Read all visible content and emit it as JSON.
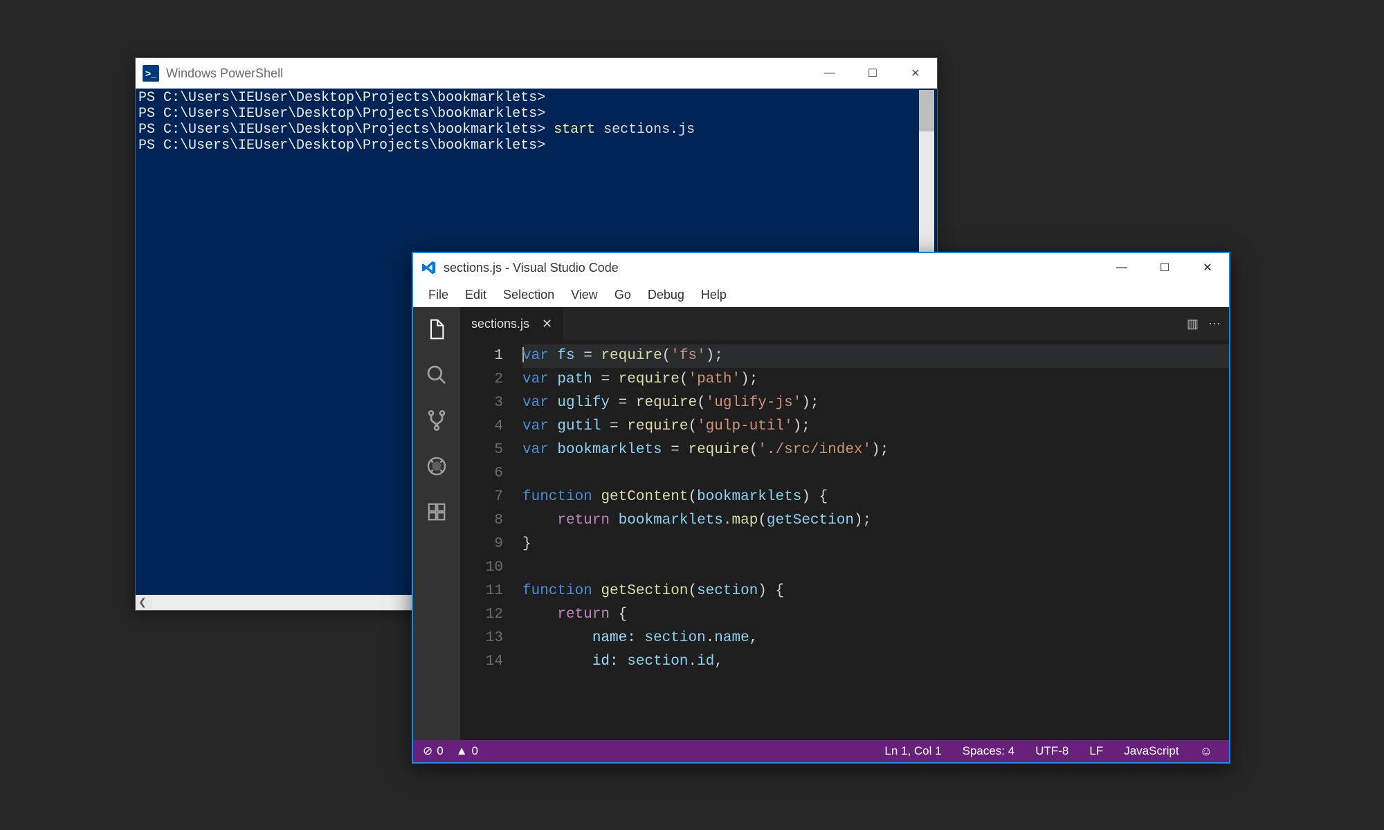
{
  "powershell": {
    "title": "Windows PowerShell",
    "win_buttons": {
      "min": "—",
      "max": "☐",
      "close": "✕"
    },
    "prompt": "PS C:\\Users\\IEUser\\Desktop\\Projects\\bookmarklets>",
    "command_cmd": "start",
    "command_arg": "sections.js",
    "lines": [
      {
        "type": "prompt_only"
      },
      {
        "type": "prompt_only"
      },
      {
        "type": "command"
      },
      {
        "type": "prompt_only"
      }
    ]
  },
  "vscode": {
    "title": "sections.js - Visual Studio Code",
    "win_buttons": {
      "min": "—",
      "max": "☐",
      "close": "✕"
    },
    "menu": [
      "File",
      "Edit",
      "Selection",
      "View",
      "Go",
      "Debug",
      "Help"
    ],
    "activity_icons": [
      "files-icon",
      "search-icon",
      "git-icon",
      "debug-icon",
      "extensions-icon"
    ],
    "tab": {
      "name": "sections.js",
      "close": "✕"
    },
    "tab_actions": {
      "split": "▥",
      "more": "⋯"
    },
    "code_lines": [
      {
        "n": 1,
        "current": true,
        "tokens": [
          [
            "kw",
            "var"
          ],
          [
            "punc",
            " "
          ],
          [
            "var",
            "fs"
          ],
          [
            "punc",
            " = "
          ],
          [
            "fn",
            "require"
          ],
          [
            "punc",
            "("
          ],
          [
            "str",
            "'fs'"
          ],
          [
            "punc",
            ");"
          ]
        ]
      },
      {
        "n": 2,
        "tokens": [
          [
            "kw",
            "var"
          ],
          [
            "punc",
            " "
          ],
          [
            "var",
            "path"
          ],
          [
            "punc",
            " = "
          ],
          [
            "fn",
            "require"
          ],
          [
            "punc",
            "("
          ],
          [
            "str",
            "'path'"
          ],
          [
            "punc",
            ");"
          ]
        ]
      },
      {
        "n": 3,
        "tokens": [
          [
            "kw",
            "var"
          ],
          [
            "punc",
            " "
          ],
          [
            "var",
            "uglify"
          ],
          [
            "punc",
            " = "
          ],
          [
            "fn",
            "require"
          ],
          [
            "punc",
            "("
          ],
          [
            "str",
            "'uglify-js'"
          ],
          [
            "punc",
            ");"
          ]
        ]
      },
      {
        "n": 4,
        "tokens": [
          [
            "kw",
            "var"
          ],
          [
            "punc",
            " "
          ],
          [
            "var",
            "gutil"
          ],
          [
            "punc",
            " = "
          ],
          [
            "fn",
            "require"
          ],
          [
            "punc",
            "("
          ],
          [
            "str",
            "'gulp-util'"
          ],
          [
            "punc",
            ");"
          ]
        ]
      },
      {
        "n": 5,
        "tokens": [
          [
            "kw",
            "var"
          ],
          [
            "punc",
            " "
          ],
          [
            "var",
            "bookmarklets"
          ],
          [
            "punc",
            " = "
          ],
          [
            "fn",
            "require"
          ],
          [
            "punc",
            "("
          ],
          [
            "str",
            "'./src/index'"
          ],
          [
            "punc",
            ");"
          ]
        ]
      },
      {
        "n": 6,
        "tokens": []
      },
      {
        "n": 7,
        "tokens": [
          [
            "kw",
            "function"
          ],
          [
            "punc",
            " "
          ],
          [
            "fn",
            "getContent"
          ],
          [
            "punc",
            "("
          ],
          [
            "var",
            "bookmarklets"
          ],
          [
            "punc",
            ") {"
          ]
        ]
      },
      {
        "n": 8,
        "tokens": [
          [
            "punc",
            "    "
          ],
          [
            "ret",
            "return"
          ],
          [
            "punc",
            " "
          ],
          [
            "var",
            "bookmarklets"
          ],
          [
            "punc",
            "."
          ],
          [
            "fn",
            "map"
          ],
          [
            "punc",
            "("
          ],
          [
            "var",
            "getSection"
          ],
          [
            "punc",
            ");"
          ]
        ]
      },
      {
        "n": 9,
        "tokens": [
          [
            "punc",
            "}"
          ]
        ]
      },
      {
        "n": 10,
        "tokens": []
      },
      {
        "n": 11,
        "tokens": [
          [
            "kw",
            "function"
          ],
          [
            "punc",
            " "
          ],
          [
            "fn",
            "getSection"
          ],
          [
            "punc",
            "("
          ],
          [
            "var",
            "section"
          ],
          [
            "punc",
            ") {"
          ]
        ]
      },
      {
        "n": 12,
        "tokens": [
          [
            "punc",
            "    "
          ],
          [
            "ret",
            "return"
          ],
          [
            "punc",
            " {"
          ]
        ]
      },
      {
        "n": 13,
        "tokens": [
          [
            "punc",
            "        "
          ],
          [
            "prop",
            "name"
          ],
          [
            "punc",
            ": "
          ],
          [
            "var",
            "section"
          ],
          [
            "punc",
            "."
          ],
          [
            "var",
            "name"
          ],
          [
            "punc",
            ","
          ]
        ]
      },
      {
        "n": 14,
        "tokens": [
          [
            "punc",
            "        "
          ],
          [
            "prop",
            "id"
          ],
          [
            "punc",
            ": "
          ],
          [
            "var",
            "section"
          ],
          [
            "punc",
            "."
          ],
          [
            "var",
            "id"
          ],
          [
            "punc",
            ","
          ]
        ]
      }
    ],
    "status": {
      "errors_icon": "⊘",
      "errors": "0",
      "warnings_icon": "▲",
      "warnings": "0",
      "ln_col": "Ln 1, Col 1",
      "spaces": "Spaces: 4",
      "encoding": "UTF-8",
      "eol": "LF",
      "language": "JavaScript",
      "smile": "☺"
    }
  }
}
